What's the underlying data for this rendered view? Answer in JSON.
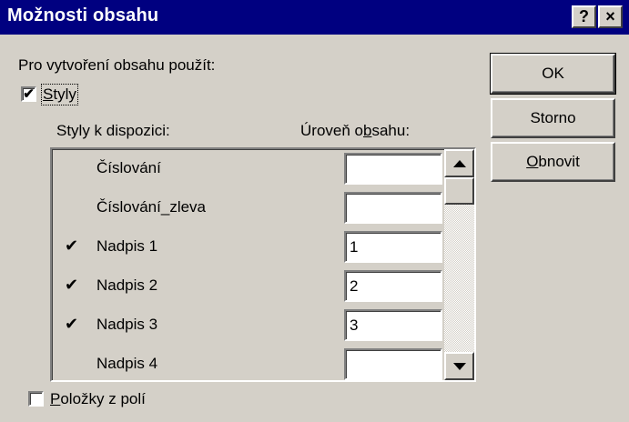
{
  "window": {
    "title": "Možnosti obsahu",
    "help_label": "?",
    "close_label": "×"
  },
  "section_label": "Pro vytvoření obsahu použít:",
  "styles_checkbox": {
    "checked": true,
    "label": "Styly"
  },
  "columns": {
    "available": "Styly k dispozici:",
    "level": "Úroveň obsahu:"
  },
  "styles": [
    {
      "checked": false,
      "name": "Číslování",
      "level": ""
    },
    {
      "checked": false,
      "name": "Číslování_zleva",
      "level": ""
    },
    {
      "checked": true,
      "name": "Nadpis 1",
      "level": "1"
    },
    {
      "checked": true,
      "name": "Nadpis 2",
      "level": "2"
    },
    {
      "checked": true,
      "name": "Nadpis 3",
      "level": "3"
    },
    {
      "checked": false,
      "name": "Nadpis 4",
      "level": ""
    }
  ],
  "fields_checkbox": {
    "checked": false,
    "label": "Položky z polí"
  },
  "buttons": {
    "ok": "OK",
    "cancel": "Storno",
    "reset": "Obnovit"
  },
  "icons": {
    "check": "checkmark-icon",
    "scroll_up": "arrow-up-icon",
    "scroll_down": "arrow-down-icon"
  }
}
